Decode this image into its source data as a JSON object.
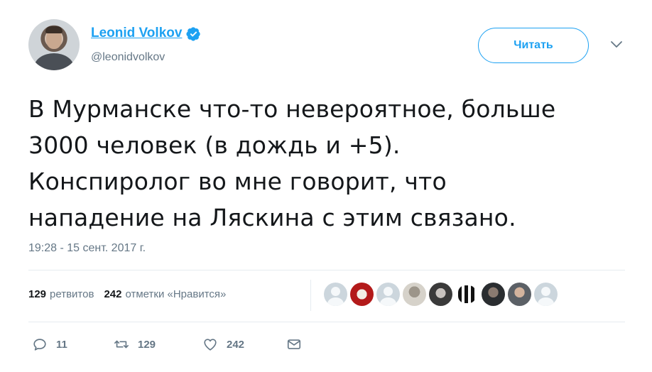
{
  "author": {
    "name": "Leonid Volkov",
    "handle": "@leonidvolkov",
    "verified_icon": "verified-badge-icon",
    "avatar_icon": "user-avatar"
  },
  "follow_button": {
    "label": "Читать"
  },
  "menu_icon": "chevron-down-icon",
  "tweet": {
    "lines": [
      "В Мурманске что-то невероятное, больше",
      "3000 человек (в дождь и +5).",
      "Конспиролог во мне говорит, что",
      "нападение на Ляскина с этим связано."
    ],
    "timestamp": "19:28 - 15 сент. 2017 г."
  },
  "stats": {
    "retweets_count": "129",
    "retweets_label": "ретвитов",
    "likes_count": "242",
    "likes_label": "отметки «Нравится»"
  },
  "liker_avatars": [
    "default",
    "red",
    "default",
    "gray",
    "dark",
    "ink",
    "man",
    "man2",
    "default"
  ],
  "actions": {
    "reply_count": "11",
    "retweet_count": "129",
    "like_count": "242",
    "colors": {
      "accent": "#1da1f2",
      "muted": "#657786",
      "text": "#14171a",
      "border": "#e6ecf0"
    }
  }
}
